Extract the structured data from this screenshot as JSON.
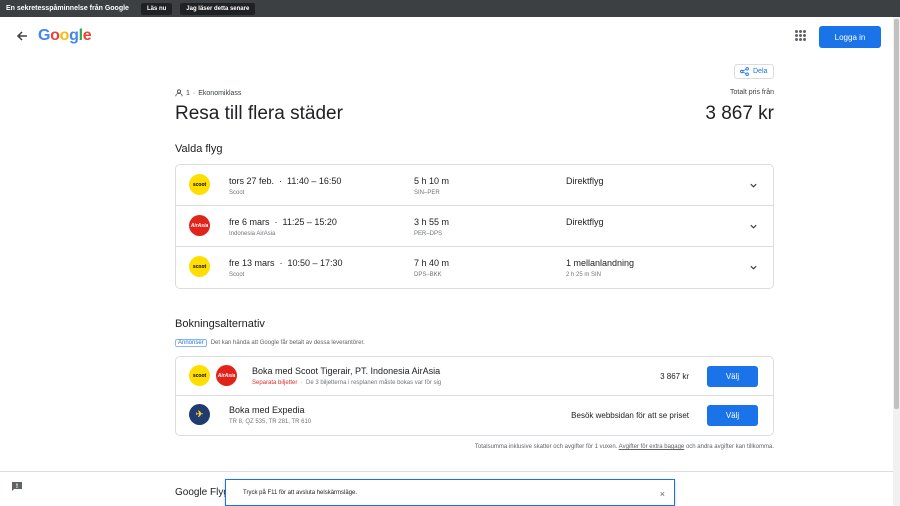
{
  "privacy_bar": {
    "message": "En sekretesspåminnelse från Google",
    "read_now": "Läs nu",
    "read_later": "Jag läser detta senare"
  },
  "header": {
    "logo": "Google",
    "login": "Logga in"
  },
  "share": "Dela",
  "trip": {
    "passengers": "1",
    "cabin": "Ekonomiklass",
    "title": "Resa till flera städer",
    "price_label": "Totalt pris från",
    "price": "3 867 kr"
  },
  "selected_flights": {
    "heading": "Valda flyg",
    "flights": [
      {
        "date": "tors 27 feb.",
        "times": "11:40 – 16:50",
        "airline": "Scoot",
        "logo": "scoot",
        "duration": "5 h 10 m",
        "route": "SIN–PER",
        "stops": "Direktflyg",
        "layover": ""
      },
      {
        "date": "fre 6 mars",
        "times": "11:25 – 15:20",
        "airline": "Indonesia AirAsia",
        "logo": "AirAsia",
        "duration": "3 h 55 m",
        "route": "PER–DPS",
        "stops": "Direktflyg",
        "layover": ""
      },
      {
        "date": "fre 13 mars",
        "times": "10:50 – 17:30",
        "airline": "Scoot",
        "logo": "scoot",
        "duration": "7 h 40 m",
        "route": "DPS–BKK",
        "stops": "1 mellanlandning",
        "layover": "2 h 25 m SIN"
      }
    ]
  },
  "booking": {
    "heading": "Bokningsalternativ",
    "ads_tag": "Annonser",
    "ads_text": "Det kan hända att Google får betalt av dessa leverantörer.",
    "options": [
      {
        "name": "Boka med Scoot Tigerair, PT. Indonesia AirAsia",
        "separate": "Separata biljetter",
        "note": "De 3 biljetterna i resplanen måste bokas var för sig",
        "price": "3 867 kr",
        "button": "Välj"
      },
      {
        "name": "Boka med Expedia",
        "flights": "TR 8, QZ 535, TR 281, TR 610",
        "price": "Besök webbsidan för att se priset",
        "button": "Välj"
      }
    ],
    "total_note_1": "Totalsumma inklusive skatter och avgifter för 1 vuxen.",
    "total_note_link": "Avgifter för extra bagage",
    "total_note_2": "och andra avgifter kan tillkomma."
  },
  "footer": {
    "logo": "Google Flyg"
  },
  "toast": {
    "message": "Tryck på F11 för att avsluta helskärmsläge.",
    "close": "×"
  }
}
